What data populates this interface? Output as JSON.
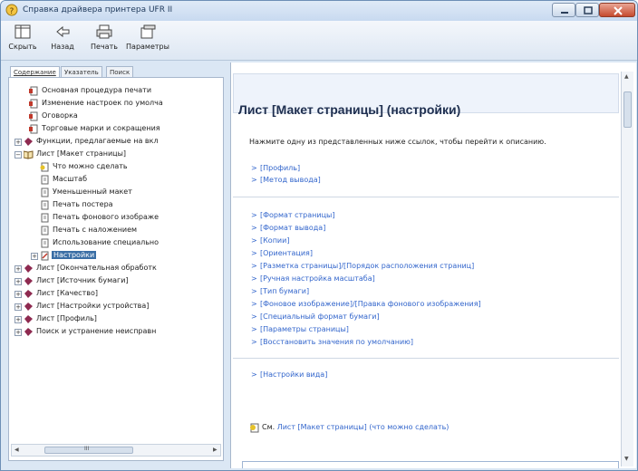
{
  "window": {
    "title": "Справка драйвера принтера UFR II"
  },
  "toolbar": {
    "hide_label": "Скрыть",
    "back_label": "Назад",
    "print_label": "Печать",
    "options_label": "Параметры"
  },
  "tabs": [
    "Содержание",
    "Указатель",
    "Поиск"
  ],
  "tree": [
    {
      "label": "Основная процедура печати",
      "icon": "help-page-icon"
    },
    {
      "label": "Изменение настроек по умолча",
      "icon": "help-page-icon"
    },
    {
      "label": "Оговорка",
      "icon": "help-page-icon"
    },
    {
      "label": "Торговые марки и сокращения",
      "icon": "help-page-icon"
    },
    {
      "label": "Функции, предлагаемые на вкл",
      "icon": "book-icon"
    },
    {
      "label": "Лист [Макет страницы]",
      "icon": "open-book-icon"
    },
    {
      "label": "Что можно сделать",
      "icon": "page-icon"
    },
    {
      "label": "Масштаб",
      "icon": "page-icon"
    },
    {
      "label": "Уменьшенный макет",
      "icon": "page-icon"
    },
    {
      "label": "Печать постера",
      "icon": "page-icon"
    },
    {
      "label": "Печать фонового изображе",
      "icon": "page-icon"
    },
    {
      "label": "Печать с наложением",
      "icon": "page-icon"
    },
    {
      "label": "Использование специально",
      "icon": "page-icon"
    },
    {
      "label": "Настройки",
      "icon": "page-icon"
    },
    {
      "label": "Лист [Окончательная обработк",
      "icon": "book-icon"
    },
    {
      "label": "Лист [Источник бумаги]",
      "icon": "book-icon"
    },
    {
      "label": "Лист [Качество]",
      "icon": "book-icon"
    },
    {
      "label": "Лист [Настройки устройства]",
      "icon": "book-icon"
    },
    {
      "label": "Лист [Профиль]",
      "icon": "book-icon"
    },
    {
      "label": "Поиск и устранение неисправн",
      "icon": "book-icon"
    }
  ],
  "content": {
    "title": "Лист [Макет страницы] (настройки)",
    "intro": "Нажмите одну из представленных ниже ссылок, чтобы перейти к описанию.",
    "group1": [
      "[Профиль]",
      "[Метод вывода]"
    ],
    "group2": [
      "[Формат страницы]",
      "[Формат вывода]",
      "[Копии]",
      "[Ориентация]",
      "[Разметка страницы]/[Порядок расположения страниц]",
      "[Ручная настройка масштаба]",
      "[Тип бумаги]",
      "[Фоновое изображение]/[Правка фонового изображения]",
      "[Специальный формат бумаги]",
      "[Параметры страницы]",
      "[Восстановить значения по умолчанию]"
    ],
    "group3": [
      "[Настройки вида]"
    ],
    "see_prefix": "См.",
    "see_link": "Лист [Макет страницы] (что можно сделать)"
  },
  "scroll": {
    "hthumb_symbol": "III"
  }
}
